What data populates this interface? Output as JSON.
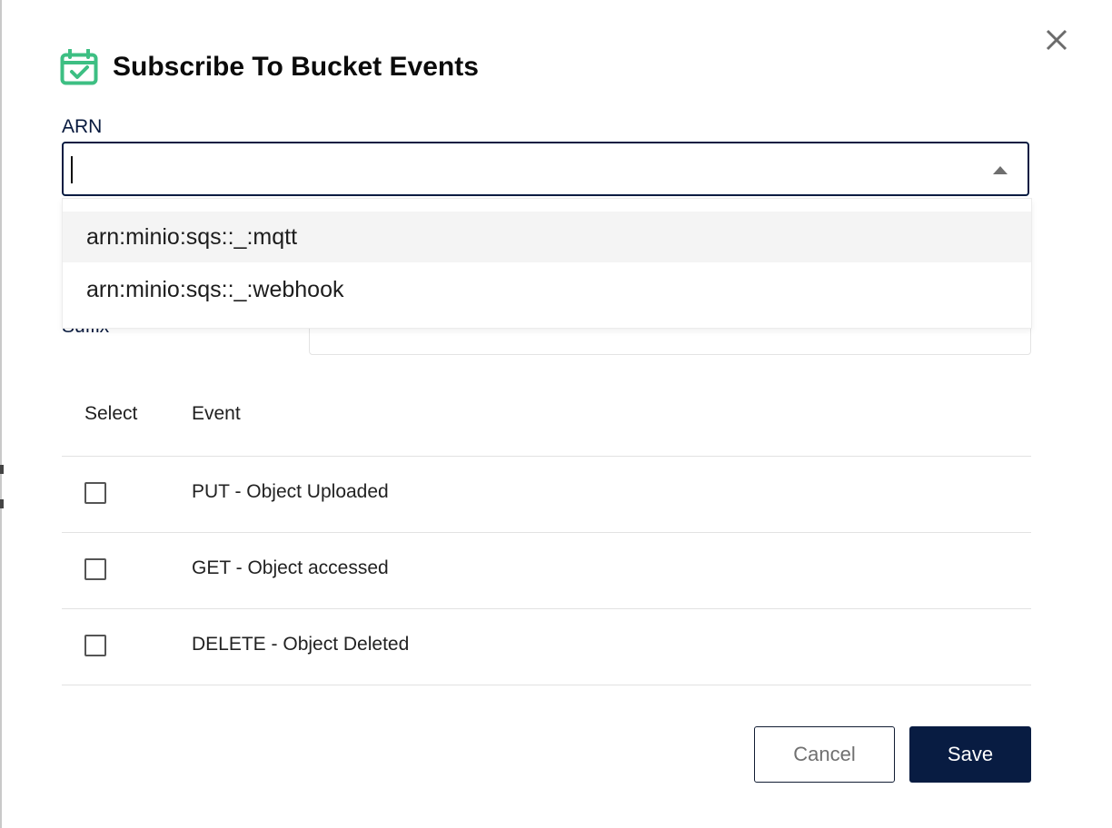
{
  "dialog": {
    "title": "Subscribe To Bucket Events",
    "title_icon": "calendar-check-icon",
    "close_icon": "close-icon",
    "accent_color": "#3dbf83"
  },
  "arn": {
    "label": "ARN",
    "value": "",
    "options": [
      "arn:minio:sqs::_:mqtt",
      "arn:minio:sqs::_:webhook"
    ]
  },
  "suffix": {
    "label": "Suffix",
    "value": ""
  },
  "events_table": {
    "headers": [
      "Select",
      "Event"
    ],
    "rows": [
      {
        "label": "PUT - Object Uploaded",
        "checked": false
      },
      {
        "label": "GET - Object accessed",
        "checked": false
      },
      {
        "label": "DELETE - Object Deleted",
        "checked": false
      }
    ]
  },
  "actions": {
    "cancel_label": "Cancel",
    "save_label": "Save",
    "primary_color": "#081c42"
  }
}
